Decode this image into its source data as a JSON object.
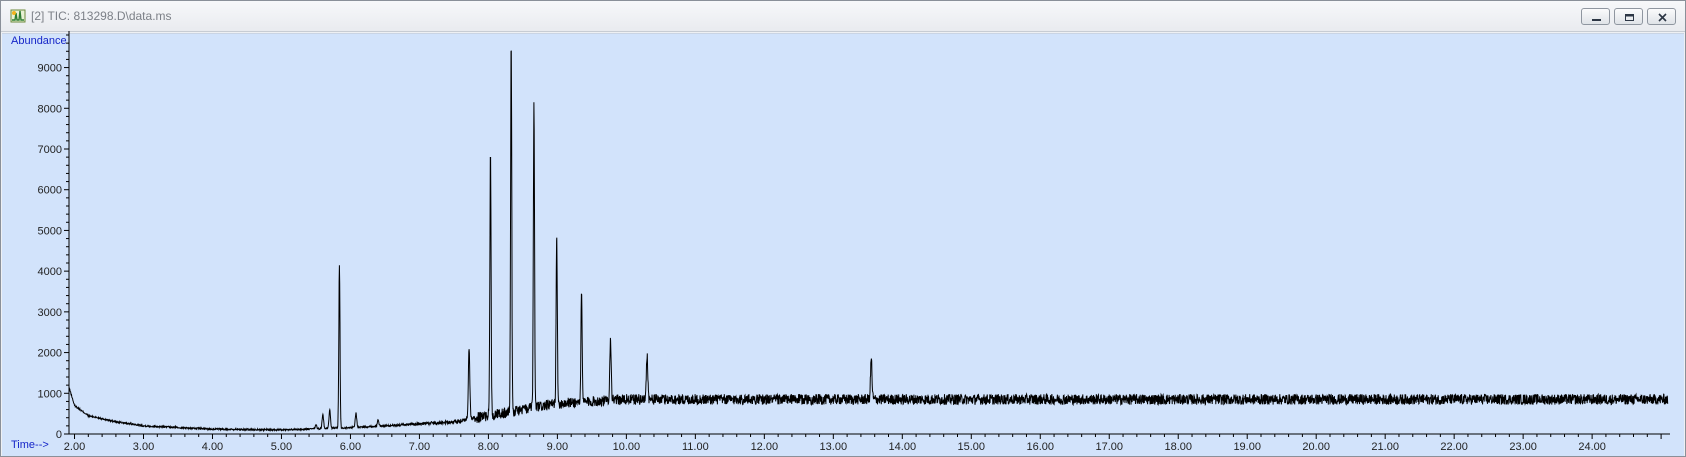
{
  "window": {
    "title": "[2] TIC: 813298.D\\data.ms",
    "icon": "chromatogram-app-icon",
    "controls": [
      "minimize",
      "restore",
      "close"
    ]
  },
  "chart_data": {
    "type": "line",
    "title": "",
    "ylabel": "Abundance",
    "xlabel": "Time-->",
    "xlim": [
      1.92,
      25.1
    ],
    "ylim": [
      0,
      9800
    ],
    "grid": false,
    "legend": "none",
    "line_color": "#000000",
    "plot_background": "#d2e3fb",
    "x_ticks": [
      "2.00",
      "3.00",
      "4.00",
      "5.00",
      "6.00",
      "7.00",
      "8.00",
      "9.00",
      "10.00",
      "11.00",
      "12.00",
      "13.00",
      "14.00",
      "15.00",
      "16.00",
      "17.00",
      "18.00",
      "19.00",
      "20.00",
      "21.00",
      "22.00",
      "23.00",
      "24.00"
    ],
    "y_ticks": [
      "0",
      "1000",
      "2000",
      "3000",
      "4000",
      "5000",
      "6000",
      "7000",
      "8000",
      "9000"
    ],
    "baseline": [
      [
        1.92,
        1150
      ],
      [
        2.0,
        700
      ],
      [
        2.2,
        450
      ],
      [
        2.6,
        300
      ],
      [
        3.0,
        200
      ],
      [
        4.0,
        120
      ],
      [
        5.0,
        100
      ],
      [
        5.4,
        120
      ],
      [
        5.9,
        150
      ],
      [
        6.5,
        200
      ],
      [
        7.0,
        250
      ],
      [
        7.5,
        300
      ],
      [
        8.0,
        450
      ],
      [
        8.5,
        600
      ],
      [
        9.0,
        750
      ],
      [
        9.5,
        800
      ],
      [
        10.0,
        850
      ],
      [
        25.1,
        850
      ]
    ],
    "peaks": [
      {
        "rt": 5.5,
        "height": 400
      },
      {
        "rt": 5.6,
        "height": 650
      },
      {
        "rt": 5.7,
        "height": 750
      },
      {
        "rt": 5.84,
        "height": 4580
      },
      {
        "rt": 6.08,
        "height": 650
      },
      {
        "rt": 6.4,
        "height": 450
      },
      {
        "rt": 7.72,
        "height": 2020
      },
      {
        "rt": 8.03,
        "height": 7230
      },
      {
        "rt": 8.33,
        "height": 9780
      },
      {
        "rt": 8.66,
        "height": 8120
      },
      {
        "rt": 8.99,
        "height": 4840
      },
      {
        "rt": 9.35,
        "height": 3370
      },
      {
        "rt": 9.77,
        "height": 1780
      },
      {
        "rt": 10.3,
        "height": 1420
      },
      {
        "rt": 13.55,
        "height": 1300
      }
    ]
  }
}
